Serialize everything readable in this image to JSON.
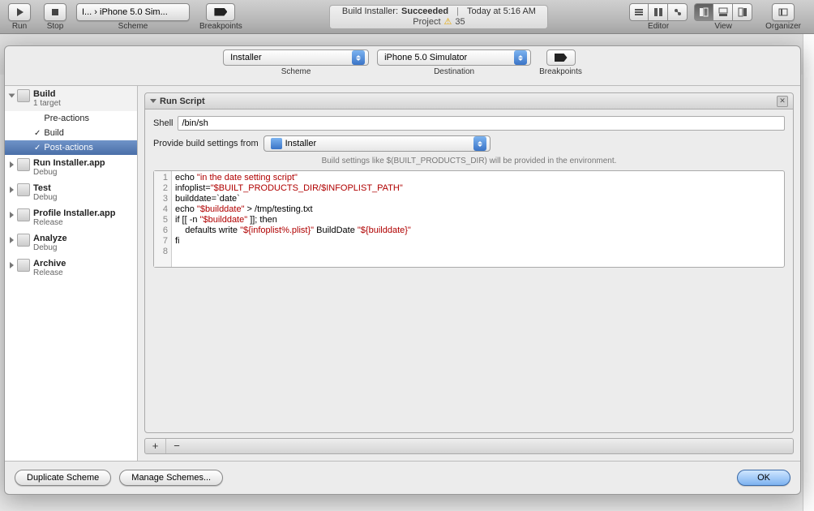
{
  "toolbar": {
    "run": "Run",
    "stop": "Stop",
    "scheme_label": "Scheme",
    "scheme_value": "I... › iPhone 5.0 Sim...",
    "breakpoints": "Breakpoints",
    "editor": "Editor",
    "view": "View",
    "organizer": "Organizer"
  },
  "status": {
    "prefix": "Build Installer:",
    "result": "Succeeded",
    "time": "Today at 5:16 AM",
    "proj_label": "Project",
    "proj_warn": "35"
  },
  "sheet": {
    "scheme": {
      "label": "Scheme",
      "value": "Installer"
    },
    "destination": {
      "label": "Destination",
      "value": "iPhone 5.0 Simulator"
    },
    "breakpoints": "Breakpoints"
  },
  "sidebar": {
    "build": {
      "title": "Build",
      "sub": "1 target",
      "children": [
        "Pre-actions",
        "Build",
        "Post-actions"
      ],
      "checked": [
        false,
        true,
        true
      ],
      "selected": 2
    },
    "items": [
      {
        "title": "Run Installer.app",
        "sub": "Debug"
      },
      {
        "title": "Test",
        "sub": "Debug"
      },
      {
        "title": "Profile Installer.app",
        "sub": "Release"
      },
      {
        "title": "Analyze",
        "sub": "Debug"
      },
      {
        "title": "Archive",
        "sub": "Release"
      }
    ]
  },
  "panel": {
    "title": "Run Script",
    "shell_label": "Shell",
    "shell_value": "/bin/sh",
    "provide_label": "Provide build settings from",
    "provide_value": "Installer",
    "hint": "Build settings like $(BUILT_PRODUCTS_DIR) will be provided in the environment.",
    "lines": [
      "1",
      "2",
      "3",
      "4",
      "5",
      "6",
      "7",
      "8"
    ],
    "code": {
      "l1a": "echo ",
      "l1b": "\"in the date setting script\"",
      "l2a": "infoplist=",
      "l2b": "\"$BUILT_PRODUCTS_DIR/$INFOPLIST_PATH\"",
      "l3": "builddate=`date`",
      "l4a": "echo ",
      "l4b": "\"$builddate\"",
      "l4c": " > /tmp/testing.txt",
      "l5a": "if [[ -n ",
      "l5b": "\"$builddate\"",
      "l5c": " ]]; then",
      "l6a": "    defaults write ",
      "l6b": "\"${infoplist%.plist}\"",
      "l6c": " BuildDate ",
      "l6d": "\"${builddate}\"",
      "l7": "fi",
      "l8": ""
    }
  },
  "footer": {
    "duplicate": "Duplicate Scheme",
    "manage": "Manage Schemes...",
    "ok": "OK"
  }
}
